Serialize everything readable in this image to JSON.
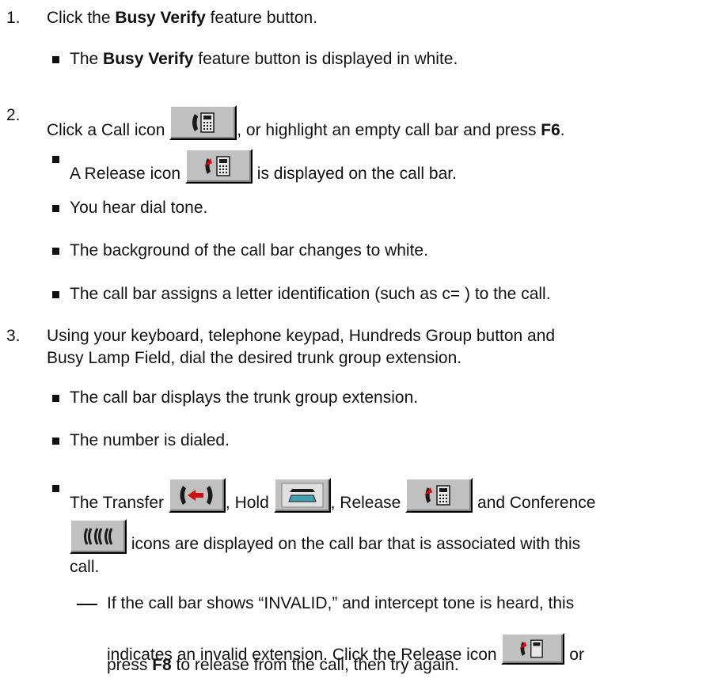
{
  "step1": {
    "number": "1.",
    "pre": "Click the ",
    "bold": "Busy Verify",
    "post": " feature button.",
    "bullet": {
      "pre": "The ",
      "bold": "Busy Verify",
      "post": " feature button is displayed in white."
    }
  },
  "step2": {
    "number": "2.",
    "pre": "Click a Call icon",
    "mid": ", or highlight an empty call bar and press ",
    "key": "F6",
    "end": ".",
    "bullets": {
      "release": {
        "pre": "A Release icon",
        "post": "is displayed on the call bar."
      },
      "dial_tone": "You hear dial tone.",
      "background": "The background of the call bar changes to white.",
      "letter": "The call bar assigns a letter identification (such as c= ) to the call."
    }
  },
  "step3": {
    "number": "3.",
    "line1": "Using your keyboard, telephone keypad, Hundreds Group button and",
    "line2": "Busy Lamp Field, dial the desired trunk group extension.",
    "bullets": {
      "displays": "The call bar displays the trunk group extension.",
      "dialed": "The number is dialed.",
      "icons": {
        "transfer": "The Transfer",
        "hold": ", Hold",
        "release": ", Release",
        "conference": "and Conference",
        "cont": "icons are displayed on the call bar that is associated with this",
        "call": "call."
      }
    },
    "note": {
      "line1": "If the call bar shows “INVALID,” and intercept tone is heard, this",
      "line2_pre": "indicates an invalid extension.  Click the Release icon",
      "line2_post": "or",
      "line3_pre": "press ",
      "line3_key": "F8",
      "line3_post": " to release from the call, then try again."
    }
  },
  "icons": [
    "call-icon",
    "release-icon",
    "transfer-icon",
    "hold-icon",
    "conference-icon"
  ],
  "colors": {
    "icon_face": "#c0c0c0",
    "arrow_red": "#d01010",
    "text": "#111111"
  }
}
